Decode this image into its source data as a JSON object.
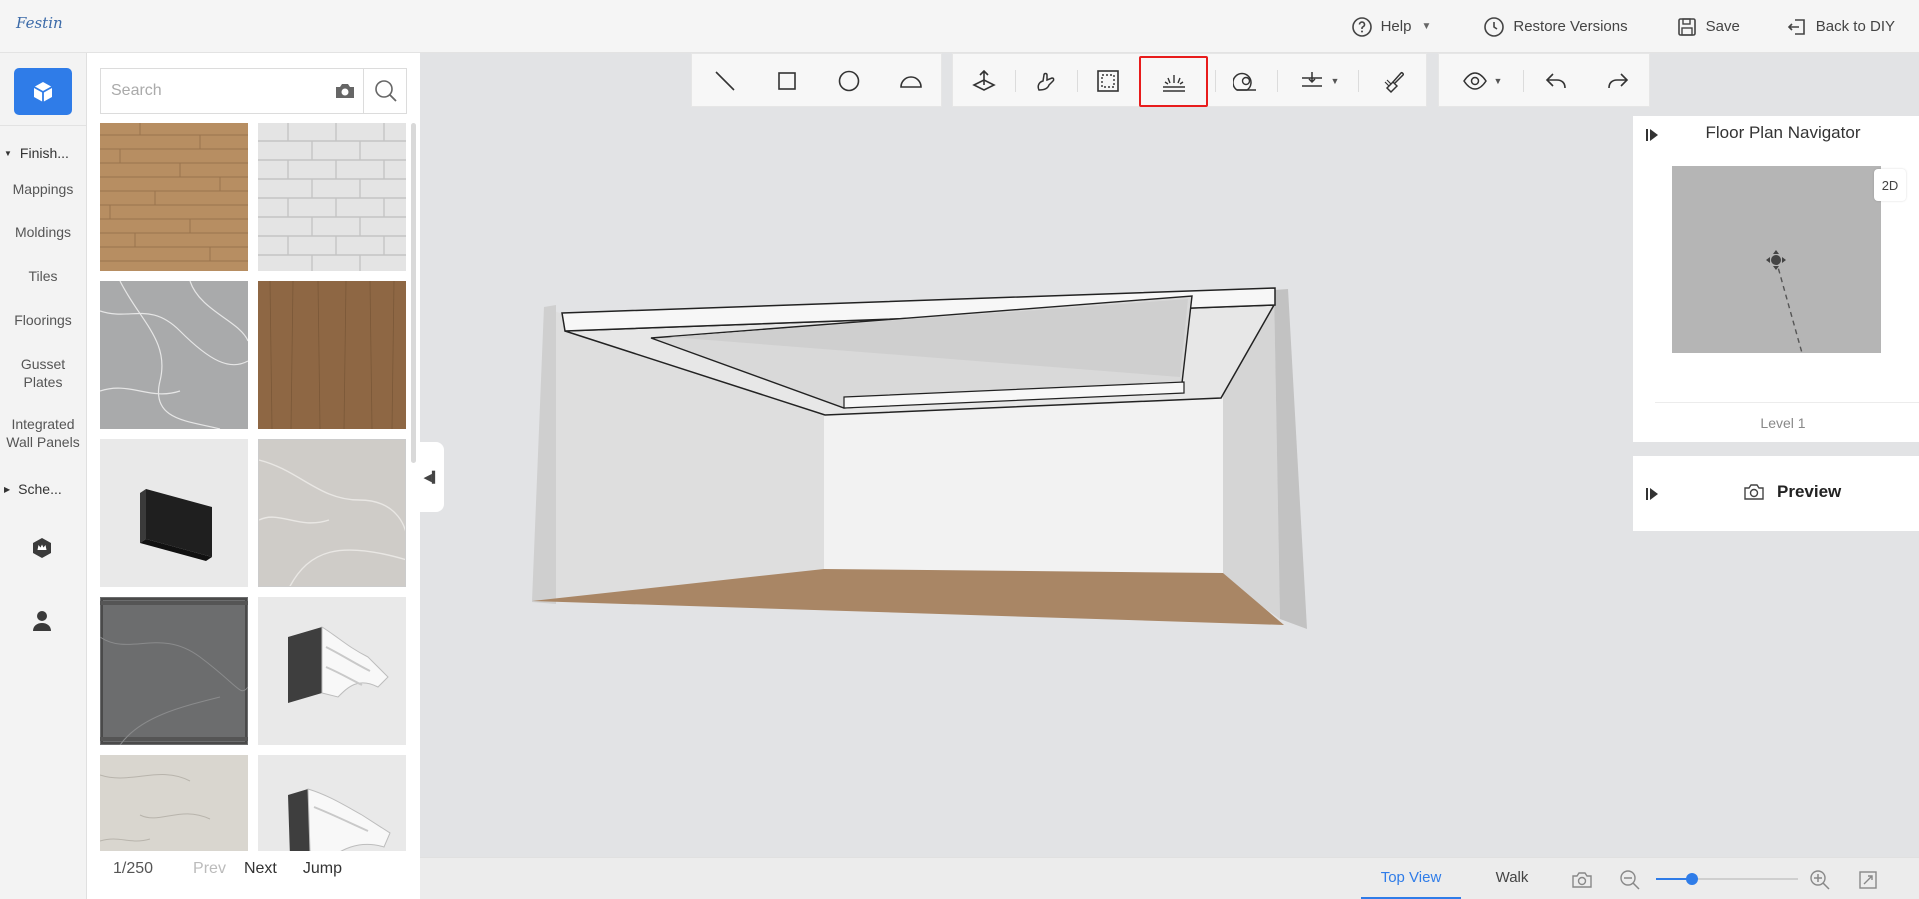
{
  "app": {
    "logo_text": "Festin"
  },
  "header": {
    "help_label": "Help",
    "restore_label": "Restore Versions",
    "save_label": "Save",
    "back_label": "Back to DIY"
  },
  "rail": {
    "group_finishes": "Finish...",
    "items": [
      "Mappings",
      "Moldings",
      "Tiles",
      "Floorings",
      "Gusset Plates",
      "Integrated Wall Panels"
    ],
    "group_schemes": "Sche..."
  },
  "catalog": {
    "search_placeholder": "Search",
    "tiles": [
      "wood-plank-light-swatch",
      "white-brick-swatch",
      "grey-marble-swatch",
      "walnut-wood-swatch",
      "black-panel-product",
      "light-marble-swatch",
      "dark-grey-marble-swatch",
      "crown-molding-product",
      "cream-stone-swatch",
      "cornice-molding-product"
    ],
    "pager": {
      "count": "1/250",
      "prev": "Prev",
      "next": "Next",
      "jump": "Jump"
    }
  },
  "toolbar": {
    "draw_tools": [
      "line-tool-icon",
      "rectangle-tool-icon",
      "circle-tool-icon",
      "arc-tool-icon"
    ],
    "edit_tools": [
      "push-pull-icon",
      "hand-tool-icon",
      "frame-select-icon",
      "light-strip-icon"
    ],
    "highlighted_tool": "light-strip-icon",
    "misc_tools": [
      "measure-icon",
      "elevation-icon",
      "paint-brush-icon"
    ],
    "view_tools": [
      "visibility-icon",
      "undo-icon",
      "redo-icon"
    ]
  },
  "navigator": {
    "title": "Floor Plan Navigator",
    "mode_button": "2D",
    "level_label": "Level 1"
  },
  "preview": {
    "label": "Preview"
  },
  "bottom": {
    "tabs": [
      "Top View",
      "Walk"
    ],
    "active_tab": "Top View",
    "zoom_level": 0.25
  },
  "colors": {
    "accent": "#2f7ce8",
    "highlight": "#e81c1c",
    "floor": "#a98665"
  }
}
